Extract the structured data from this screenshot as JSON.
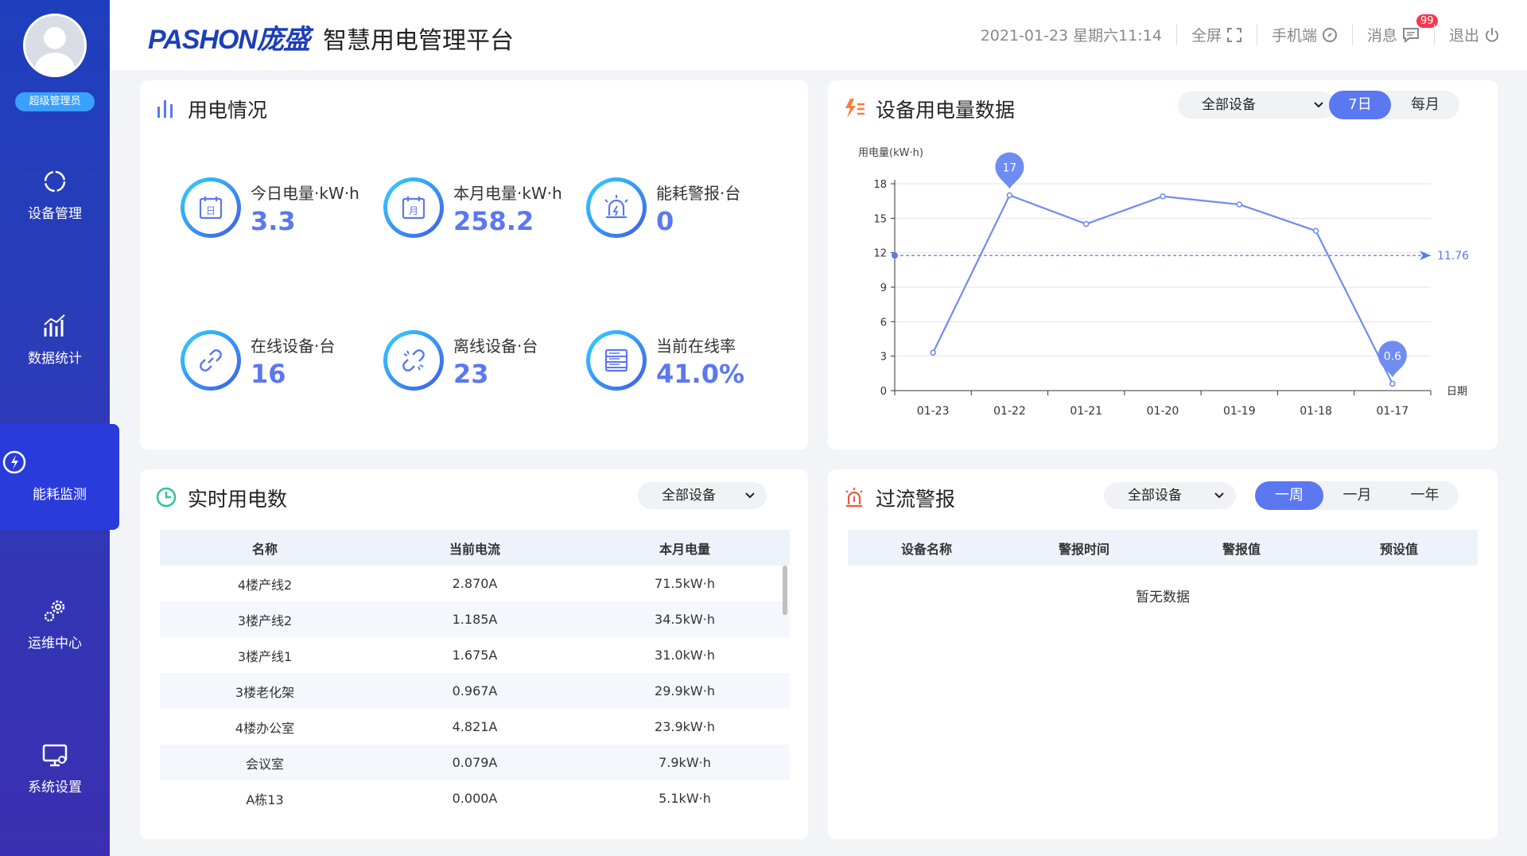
{
  "sidebar": {
    "role": "超级管理员",
    "items": [
      {
        "label": "设备管理",
        "icon": "circle-refresh-icon"
      },
      {
        "label": "数据统计",
        "icon": "bar-chart-icon"
      },
      {
        "label": "能耗监测",
        "icon": "energy-icon"
      },
      {
        "label": "运维中心",
        "icon": "gears-icon"
      },
      {
        "label": "系统设置",
        "icon": "monitor-icon"
      }
    ],
    "active_index": 2
  },
  "header": {
    "logo": "PASHON庞盛",
    "title": "智慧用电管理平台",
    "datetime": "2021-01-23 星期六11:14",
    "fullscreen": "全屏",
    "mobile": "手机端",
    "messages": "消息",
    "message_count": "99",
    "logout": "退出"
  },
  "usage": {
    "title": "用电情况",
    "stats": [
      {
        "label": "今日电量·kW·h",
        "value": "3.3",
        "icon": "calendar-day-icon"
      },
      {
        "label": "本月电量·kW·h",
        "value": "258.2",
        "icon": "calendar-month-icon"
      },
      {
        "label": "能耗警报·台",
        "value": "0",
        "icon": "alarm-light-icon"
      },
      {
        "label": "在线设备·台",
        "value": "16",
        "icon": "link-icon"
      },
      {
        "label": "离线设备·台",
        "value": "23",
        "icon": "broken-link-icon"
      },
      {
        "label": "当前在线率",
        "value": "41.0%",
        "icon": "server-icon"
      }
    ]
  },
  "device_chart": {
    "title": "设备用电量数据",
    "select": "全部设备",
    "tabs": [
      "7日",
      "每月"
    ],
    "active_tab": 0
  },
  "chart_data": {
    "type": "line",
    "ylabel": "用电量(kW·h)",
    "xlabel": "日期",
    "categories": [
      "01-23",
      "01-22",
      "01-21",
      "01-20",
      "01-19",
      "01-18",
      "01-17"
    ],
    "values": [
      3.3,
      17,
      14.5,
      16.9,
      16.2,
      13.9,
      0.6
    ],
    "ylim": [
      0,
      18
    ],
    "yticks": [
      0,
      3,
      6,
      9,
      12,
      15,
      18
    ],
    "average": 11.76,
    "max_label": "17",
    "min_label": "0.6",
    "average_label": "11.76"
  },
  "realtime": {
    "title": "实时用电数",
    "select": "全部设备",
    "columns": [
      "名称",
      "当前电流",
      "本月电量"
    ],
    "rows": [
      [
        "4楼产线2",
        "2.870A",
        "71.5kW·h"
      ],
      [
        "3楼产线2",
        "1.185A",
        "34.5kW·h"
      ],
      [
        "3楼产线1",
        "1.675A",
        "31.0kW·h"
      ],
      [
        "3楼老化架",
        "0.967A",
        "29.9kW·h"
      ],
      [
        "4楼办公室",
        "4.821A",
        "23.9kW·h"
      ],
      [
        "会议室",
        "0.079A",
        "7.9kW·h"
      ],
      [
        "A栋13",
        "0.000A",
        "5.1kW·h"
      ]
    ]
  },
  "alarm": {
    "title": "过流警报",
    "select": "全部设备",
    "tabs": [
      "一周",
      "一月",
      "一年"
    ],
    "active_tab": 0,
    "columns": [
      "设备名称",
      "警报时间",
      "警报值",
      "预设值"
    ],
    "empty_text": "暂无数据"
  }
}
